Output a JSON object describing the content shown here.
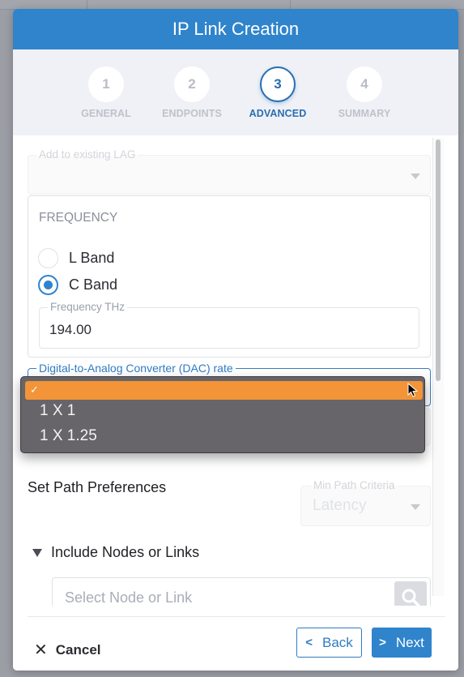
{
  "dialog": {
    "title": "IP Link Creation"
  },
  "steps": [
    {
      "number": "1",
      "label": "GENERAL",
      "active": false
    },
    {
      "number": "2",
      "label": "ENDPOINTS",
      "active": false
    },
    {
      "number": "3",
      "label": "ADVANCED",
      "active": true
    },
    {
      "number": "4",
      "label": "SUMMARY",
      "active": false
    }
  ],
  "form": {
    "lag": {
      "label": "Add to existing LAG",
      "value": ""
    },
    "frequency": {
      "title": "FREQUENCY",
      "options": [
        {
          "label": "L Band",
          "checked": false
        },
        {
          "label": "C Band",
          "checked": true
        }
      ],
      "thz_label": "Frequency THz",
      "thz_value": "194.00"
    },
    "dac": {
      "label": "Digital-to-Analog Converter (DAC) rate",
      "selected": "",
      "options": [
        "",
        "1 X 1",
        "1 X 1.25"
      ],
      "check_glyph": "✓"
    },
    "path": {
      "title": "Set Path Preferences",
      "min_criteria_label": "Min Path Criteria",
      "min_criteria_value": "Latency"
    },
    "include": {
      "label": "Include Nodes or Links",
      "search_placeholder": "Select Node or Link"
    }
  },
  "footer": {
    "cancel_label": "Cancel",
    "back_label": "Back",
    "next_label": "Next"
  },
  "colors": {
    "header": "#2f84cc",
    "accent": "#2f7cc2",
    "selected_option": "#f29437",
    "popup_bg": "#67646a"
  }
}
